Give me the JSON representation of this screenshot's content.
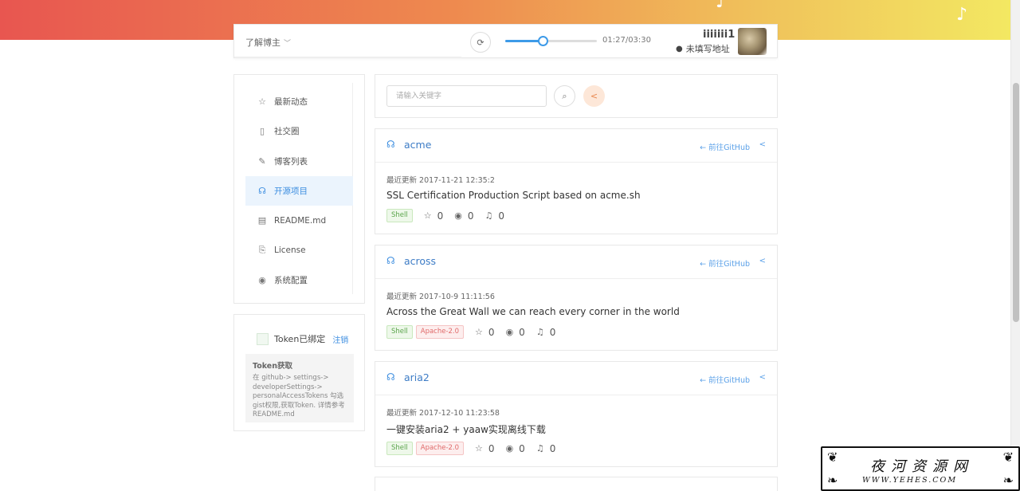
{
  "header": {
    "about_label": "了解博主",
    "player": {
      "time": "01:27/03:30",
      "progress": 0.41
    },
    "username": "iiiiiii1",
    "location": "未填写地址",
    "note_glyph": "♪"
  },
  "sidebar": {
    "items": [
      {
        "label": "最新动态",
        "icon": "star-icon",
        "glyph": "☆",
        "active": false
      },
      {
        "label": "社交圈",
        "icon": "phone-icon",
        "glyph": "▯",
        "active": false
      },
      {
        "label": "博客列表",
        "icon": "edit-icon",
        "glyph": "✎",
        "active": false
      },
      {
        "label": "开源项目",
        "icon": "headphones-icon",
        "glyph": "☊",
        "active": true
      },
      {
        "label": "README.md",
        "icon": "file-icon",
        "glyph": "▤",
        "active": false
      },
      {
        "label": "License",
        "icon": "license-icon",
        "glyph": "⎘",
        "active": false
      },
      {
        "label": "系统配置",
        "icon": "settings-icon",
        "glyph": "◉",
        "active": false
      }
    ]
  },
  "token": {
    "status": "Token已绑定",
    "logout": "注销",
    "help_title": "Token获取",
    "help_body": "在 github-> settings-> developerSettings-> personalAccessTokens 勾选gist权限,获取Token. 详情参考README.md"
  },
  "search": {
    "placeholder": "请输入关键字"
  },
  "repos": [
    {
      "name": "acme",
      "github_link": "← 前往GitHub",
      "updated_label": "最近更新",
      "updated": "2017-11-21 12:35:2",
      "description": "SSL Certification Production Script based on acme.sh",
      "language": "Shell",
      "license": "",
      "stars": "0",
      "watchers": "0",
      "subscribers": "0"
    },
    {
      "name": "across",
      "github_link": "← 前往GitHub",
      "updated_label": "最近更新",
      "updated": "2017-10-9 11:11:56",
      "description": "Across the Great Wall we can reach every corner in the world",
      "language": "Shell",
      "license": "Apache-2.0",
      "stars": "0",
      "watchers": "0",
      "subscribers": "0"
    },
    {
      "name": "aria2",
      "github_link": "← 前往GitHub",
      "updated_label": "最近更新",
      "updated": "2017-12-10 11:23:58",
      "description": "一键安装aria2 + yaaw实现离线下载",
      "language": "Shell",
      "license": "Apache-2.0",
      "stars": "0",
      "watchers": "0",
      "subscribers": "0"
    }
  ],
  "watermark": {
    "title": "夜河资源网",
    "url": "WWW.YEHES.COM"
  },
  "colors": {
    "accent": "#3d8ee0",
    "gradient_start": "#e85650",
    "gradient_end": "#f3e862"
  }
}
